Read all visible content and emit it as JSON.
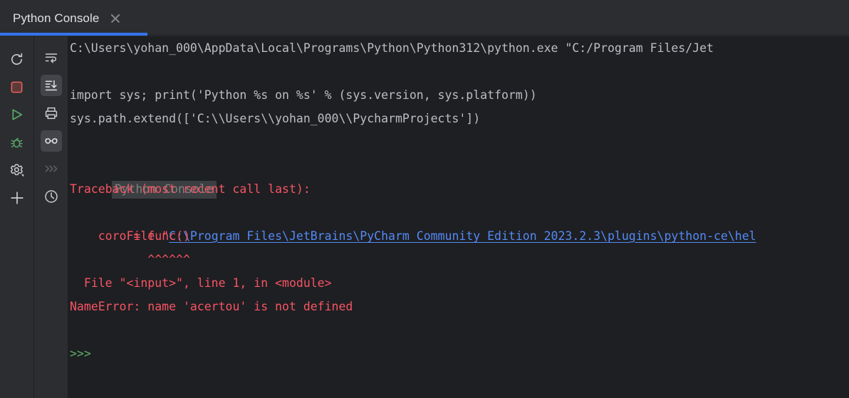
{
  "window": {
    "background_color": "#1e1f22",
    "toolbar_color": "#2b2d30",
    "accent_color": "#3573f0"
  },
  "tab": {
    "title": "Python Console",
    "close_icon": "close-icon",
    "active": true
  },
  "toolbar_left": {
    "buttons": [
      {
        "name": "rerun-console-button",
        "icon": "rerun-icon",
        "label": "Rerun",
        "color": "#c9ccd1"
      },
      {
        "name": "stop-button",
        "icon": "stop-square-icon",
        "label": "Stop",
        "color": "#e8605d"
      },
      {
        "name": "execute-button",
        "icon": "run-triangle-icon",
        "label": "Execute",
        "color": "#59a869"
      },
      {
        "name": "debug-button",
        "icon": "debug-bug-icon",
        "label": "Debug",
        "color": "#59a869"
      },
      {
        "name": "settings-button",
        "icon": "gear-icon",
        "label": "Settings",
        "color": "#c9ccd1"
      },
      {
        "name": "new-console-button",
        "icon": "plus-icon",
        "label": "New Console",
        "color": "#c9ccd1"
      }
    ]
  },
  "toolbar_second": {
    "buttons": [
      {
        "name": "soft-wrap-button",
        "icon": "soft-wrap-icon",
        "label": "Use Soft Wraps",
        "selected": false
      },
      {
        "name": "scroll-to-end-button",
        "icon": "scroll-to-end-icon",
        "label": "Scroll to the end",
        "selected": true
      },
      {
        "name": "print-button",
        "icon": "printer-icon",
        "label": "Print",
        "selected": false
      },
      {
        "name": "view-as-button",
        "icon": "glasses-icon",
        "label": "Preview",
        "selected": true
      },
      {
        "name": "show-prompt-button",
        "icon": "chevrons-right-icon",
        "label": "Show Prompt",
        "selected": false,
        "dimmed": true
      },
      {
        "name": "command-history-button",
        "icon": "clock-icon",
        "label": "Command History",
        "selected": false
      }
    ]
  },
  "console": {
    "prompt_symbol": ">>>",
    "lines": [
      {
        "type": "output",
        "text": "C:\\Users\\yohan_000\\AppData\\Local\\Programs\\Python\\Python312\\python.exe \"C:/Program Files/Jet"
      },
      {
        "type": "blank",
        "text": ""
      },
      {
        "type": "output",
        "text": "import sys; print('Python %s on %s' % (sys.version, sys.platform))"
      },
      {
        "type": "output",
        "text": "sys.path.extend(['C:\\\\Users\\\\yohan_000\\\\PycharmProjects'])"
      },
      {
        "type": "blank",
        "text": ""
      },
      {
        "type": "system-highlight",
        "text": "Python Console"
      },
      {
        "type": "error",
        "text": "Traceback (most recent call last):"
      },
      {
        "type": "error-link",
        "prefix": "  File \"",
        "link": "C:\\Program Files\\JetBrains\\PyCharm Community Edition 2023.2.3\\plugins\\python-ce\\hel"
      },
      {
        "type": "error",
        "text": "    coro = func()"
      },
      {
        "type": "error",
        "text": "           ^^^^^^"
      },
      {
        "type": "error",
        "text": "  File \"<input>\", line 1, in <module>"
      },
      {
        "type": "error",
        "text": "NameError: name 'acertou' is not defined"
      },
      {
        "type": "blank",
        "text": ""
      },
      {
        "type": "prompt",
        "text": ">>>"
      }
    ]
  }
}
